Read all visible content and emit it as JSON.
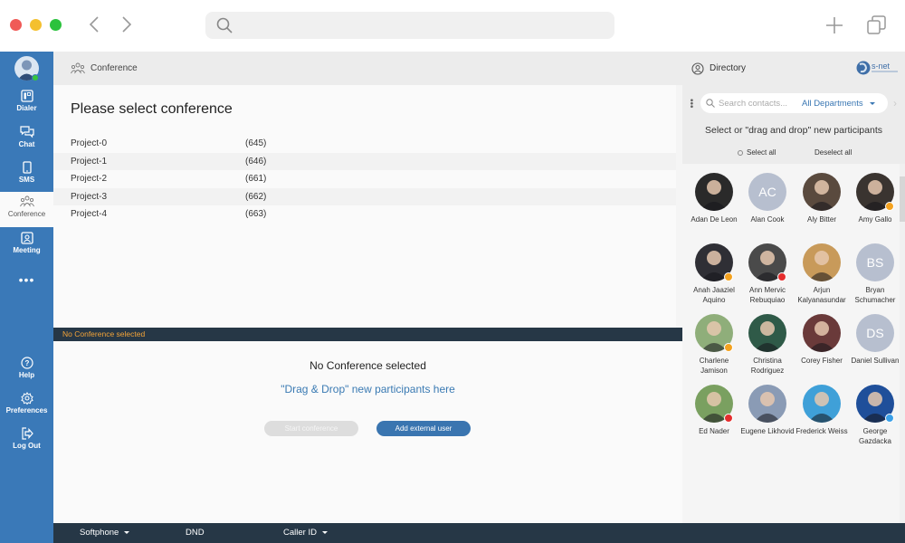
{
  "window": {
    "controls": {
      "close_color": "#f05a57",
      "minimize_color": "#f4c02f",
      "maximize_color": "#2bc23d"
    },
    "back_icon": "chevron-left-icon",
    "forward_icon": "chevron-right-icon",
    "address_bar": {
      "value": "",
      "icon": "search-icon"
    },
    "new_tab_icon": "plus-icon",
    "tabs_icon": "tabs-icon"
  },
  "sidebar": {
    "user_status": "online",
    "items": [
      {
        "label": "Dialer",
        "icon": "dialer-icon"
      },
      {
        "label": "Chat",
        "icon": "chat-icon"
      },
      {
        "label": "SMS",
        "icon": "sms-icon"
      },
      {
        "label": "Conference",
        "icon": "conference-icon",
        "active": true
      },
      {
        "label": "Meeting",
        "icon": "meeting-icon"
      }
    ],
    "more_label": "•••",
    "bottom_items": [
      {
        "label": "Help",
        "icon": "help-icon"
      },
      {
        "label": "Preferences",
        "icon": "gear-icon"
      },
      {
        "label": "Log Out",
        "icon": "logout-icon"
      }
    ]
  },
  "main": {
    "header_title": "Conference",
    "page_title": "Please select conference",
    "conferences": [
      {
        "name": "Project-0",
        "number": "(645)"
      },
      {
        "name": "Project-1",
        "number": "(646)"
      },
      {
        "name": "Project-2",
        "number": "(661)"
      },
      {
        "name": "Project-3",
        "number": "(662)"
      },
      {
        "name": "Project-4",
        "number": "(663)"
      }
    ],
    "status_bar": "No Conference selected",
    "no_conference_text": "No Conference selected",
    "drag_drop_text": "\"Drag & Drop\" new participants here",
    "start_button": "Start conference",
    "add_external_button": "Add external user"
  },
  "footer": {
    "softphone": "Softphone",
    "dnd": "DND",
    "caller_id": "Caller ID"
  },
  "directory": {
    "title": "Directory",
    "logo_text": "s-net",
    "search_placeholder": "Search contacts...",
    "department": "All Departments",
    "hint": "Select or \"drag and drop\" new participants",
    "select_all": "Select all",
    "deselect_all": "Deselect all",
    "contacts": [
      {
        "name": "Adan De Leon",
        "initials": "",
        "photo_color": "#2a2a2a",
        "status": ""
      },
      {
        "name": "Alan Cook",
        "initials": "AC",
        "photo_color": "#b7bfcf",
        "status": ""
      },
      {
        "name": "Aly Bitter",
        "initials": "",
        "photo_color": "#5a4a3e",
        "status": ""
      },
      {
        "name": "Amy Gallo",
        "initials": "",
        "photo_color": "#3a3430",
        "status": "away"
      },
      {
        "name": "Anah Jaaziel Aquino",
        "initials": "",
        "photo_color": "#2f2f35",
        "status": "away"
      },
      {
        "name": "Ann Mervic Rebuquiao",
        "initials": "",
        "photo_color": "#4a4a4a",
        "status": "dnd"
      },
      {
        "name": "Arjun Kalyanasundar",
        "initials": "",
        "photo_color": "#c89a5a",
        "status": ""
      },
      {
        "name": "Bryan Schumacher",
        "initials": "BS",
        "photo_color": "#b7bfcf",
        "status": ""
      },
      {
        "name": "Charlene Jamison",
        "initials": "",
        "photo_color": "#8fae7a",
        "status": "away"
      },
      {
        "name": "Christina Rodriguez",
        "initials": "",
        "photo_color": "#2f5a48",
        "status": ""
      },
      {
        "name": "Corey Fisher",
        "initials": "",
        "photo_color": "#6a3a3a",
        "status": ""
      },
      {
        "name": "Daniel Sullivan",
        "initials": "DS",
        "photo_color": "#b7bfcf",
        "status": ""
      },
      {
        "name": "Ed Nader",
        "initials": "",
        "photo_color": "#7aa060",
        "status": "busy"
      },
      {
        "name": "Eugene Likhovid",
        "initials": "",
        "photo_color": "#8a9bb5",
        "status": ""
      },
      {
        "name": "Frederick Weiss",
        "initials": "",
        "photo_color": "#3fa0d8",
        "status": ""
      },
      {
        "name": "George Gazdacka",
        "initials": "",
        "photo_color": "#1f4f9a",
        "status": "mobile"
      }
    ],
    "status_colors": {
      "away": "#f4a21f",
      "dnd": "#e52d2d",
      "busy": "#e52d2d",
      "mobile": "#3aa0e8"
    }
  }
}
